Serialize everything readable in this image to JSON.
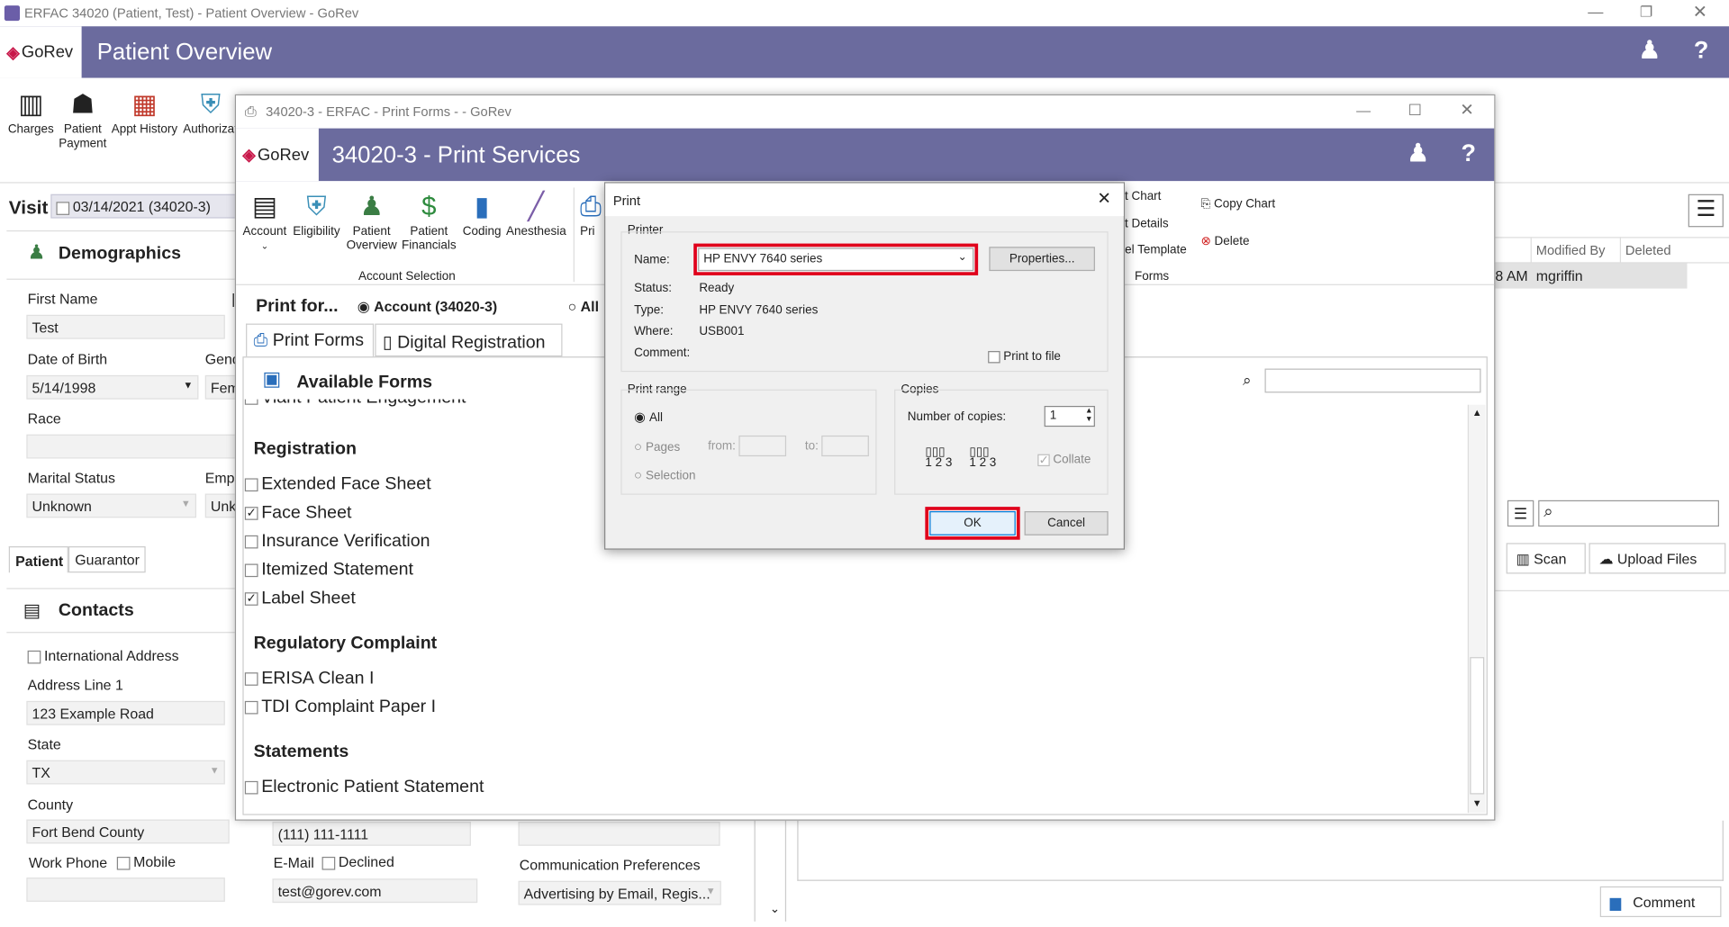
{
  "window": {
    "title": "ERFAC 34020 (Patient, Test) - Patient Overview - GoRev"
  },
  "main_header": {
    "logo": "GoRev",
    "title": "Patient Overview"
  },
  "main_toolbar": [
    {
      "label": "Charges",
      "icon": "barcode-icon"
    },
    {
      "label": "Patient Payment",
      "icon": "payment-icon"
    },
    {
      "label": "Appt History",
      "icon": "calendar-icon"
    },
    {
      "label": "Authorizat",
      "icon": "shield-check-icon"
    }
  ],
  "visit": {
    "label": "Visit",
    "value": "03/14/2021 (34020-3)"
  },
  "demographics": {
    "title": "Demographics",
    "first_name_label": "First Name",
    "first_name": "Test",
    "dob_label": "Date of Birth",
    "dob": "5/14/1998",
    "gender_label": "Gend",
    "gender": "Fem",
    "race_label": "Race",
    "race": "",
    "marital_label": "Marital Status",
    "marital": "Unknown",
    "empl_label": "Empl",
    "empl": "Unk",
    "tab_patient": "Patient",
    "tab_guarantor": "Guarantor"
  },
  "contacts": {
    "title": "Contacts",
    "intl_label": "International Address",
    "addr1_label": "Address Line 1",
    "addr1": "123 Example Road",
    "state_label": "State",
    "state": "TX",
    "county_label": "County",
    "county": "Fort Bend County",
    "work_phone_label": "Work Phone",
    "mobile_label": "Mobile",
    "phone": "(111) 111-1111",
    "email_label": "E-Mail",
    "declined_label": "Declined",
    "email": "test@gorev.com",
    "comm_label": "Communication Preferences",
    "comm": "Advertising by Email, Regis..."
  },
  "right_panel": {
    "modified_by_header": "Modified By",
    "deleted_header": "Deleted",
    "time": "8 AM",
    "user": "mgriffin",
    "scan": "Scan",
    "upload": "Upload Files",
    "comment": "Comment"
  },
  "print_window": {
    "title": "34020-3 - ERFAC - Print Forms -  - GoRev",
    "header_title": "34020-3 - Print Services",
    "logo": "GoRev",
    "toolbar": [
      {
        "label": "Account",
        "icon": "account-card-icon"
      },
      {
        "label": "Eligibility",
        "icon": "shield-check-icon"
      },
      {
        "label": "Patient Overview",
        "icon": "person-icon"
      },
      {
        "label": "Patient Financials",
        "icon": "dollar-icon"
      },
      {
        "label": "Coding",
        "icon": "book-plus-icon"
      },
      {
        "label": "Anesthesia",
        "icon": "syringe-icon"
      },
      {
        "label": "Pri",
        "icon": "printer-icon"
      }
    ],
    "group_label": "Account Selection",
    "right_items": [
      "t Chart",
      "t Details",
      "bel Template"
    ],
    "right_group": "Forms",
    "copy_chart": "Copy Chart",
    "delete": "Delete",
    "print_for": "Print for...",
    "account_option": "Account (34020-3)",
    "all_option": "All",
    "tab_print_forms": "Print Forms",
    "tab_digital": "Digital Registration",
    "available_forms": "Available Forms",
    "partial_item": "Viant Patient Engagement",
    "groups": [
      {
        "name": "Registration",
        "items": [
          {
            "label": "Extended Face Sheet",
            "checked": false
          },
          {
            "label": "Face Sheet",
            "checked": true
          },
          {
            "label": "Insurance Verification",
            "checked": false
          },
          {
            "label": "Itemized Statement",
            "checked": false
          },
          {
            "label": "Label Sheet",
            "checked": true
          }
        ]
      },
      {
        "name": "Regulatory Complaint",
        "items": [
          {
            "label": "ERISA Clean I",
            "checked": false
          },
          {
            "label": "TDI Complaint Paper I",
            "checked": false
          }
        ]
      },
      {
        "name": "Statements",
        "items": [
          {
            "label": "Electronic Patient Statement",
            "checked": false
          }
        ]
      }
    ]
  },
  "print_dialog": {
    "title": "Print",
    "printer_group": "Printer",
    "name_label": "Name:",
    "name_value": "HP ENVY 7640 series",
    "properties": "Properties...",
    "status_label": "Status:",
    "status": "Ready",
    "type_label": "Type:",
    "type": "HP ENVY 7640 series",
    "where_label": "Where:",
    "where": "USB001",
    "comment_label": "Comment:",
    "print_to_file": "Print to file",
    "range_group": "Print range",
    "all": "All",
    "pages": "Pages",
    "from": "from:",
    "to": "to:",
    "selection": "Selection",
    "copies_group": "Copies",
    "num_copies_label": "Number of copies:",
    "num_copies": "1",
    "collate": "Collate",
    "ok": "OK",
    "cancel": "Cancel",
    "highlight_color": "#e0001b"
  }
}
